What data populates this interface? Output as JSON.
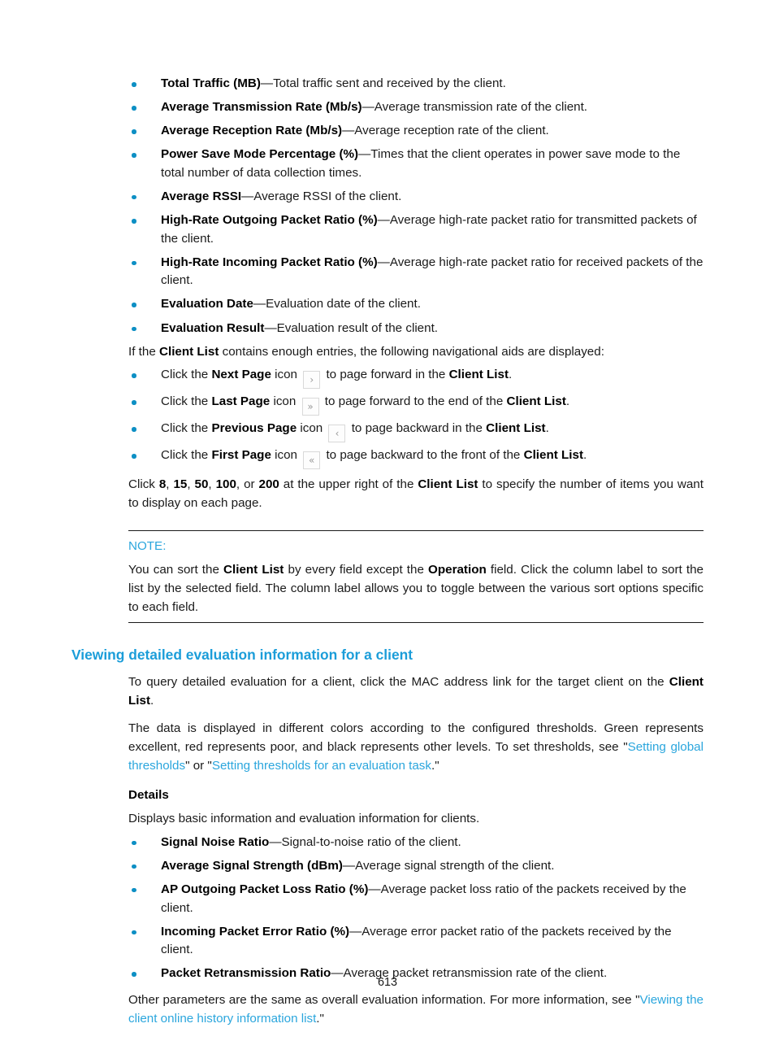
{
  "document": {
    "page_number": "613",
    "accent_color": "#1b9dd9",
    "bullet_color": "#0d8fc4",
    "link_color": "#2ba6dd"
  },
  "metrics_list": [
    {
      "term": "Total Traffic (MB)",
      "dash": "—",
      "desc": "Total traffic sent and received by the client."
    },
    {
      "term": "Average Transmission Rate (Mb/s)",
      "dash": "—",
      "desc": "Average transmission rate of the client."
    },
    {
      "term": "Average Reception Rate (Mb/s)",
      "dash": "—",
      "desc": "Average reception rate of the client."
    },
    {
      "term": "Power Save Mode Percentage (%)",
      "dash": "—",
      "desc": "Times that the client operates in power save mode to the total number of data collection times."
    },
    {
      "term": "Average RSSI",
      "dash": "—",
      "desc": "Average RSSI of the client."
    },
    {
      "term": "High-Rate Outgoing Packet Ratio (%)",
      "dash": "—",
      "desc": "Average high-rate packet ratio for transmitted packets of the client."
    },
    {
      "term": "High-Rate Incoming Packet Ratio (%)",
      "dash": "—",
      "desc": "Average high-rate packet ratio for received packets of the client."
    },
    {
      "term": "Evaluation Date",
      "dash": "—",
      "desc": "Evaluation date of the client."
    },
    {
      "term": "Evaluation Result",
      "dash": "—",
      "desc": "Evaluation result of the client."
    }
  ],
  "nav_intro": {
    "text_before": "If the ",
    "bold": "Client List",
    "text_after": " contains enough entries, the following navigational aids are displayed:"
  },
  "nav_aids": [
    {
      "click": "Click the ",
      "name": "Next Page",
      "icon_word": " icon ",
      "glyph": "›",
      "icon_name": "next-page-icon",
      "after": " to page forward in the ",
      "target": "Client List",
      "end": "."
    },
    {
      "click": "Click the ",
      "name": "Last Page",
      "icon_word": " icon ",
      "glyph": "»",
      "icon_name": "last-page-icon",
      "after": " to page forward to the end of the ",
      "target": "Client List",
      "end": "."
    },
    {
      "click": "Click the ",
      "name": "Previous Page",
      "icon_word": " icon ",
      "glyph": "‹",
      "icon_name": "previous-page-icon",
      "after": " to page backward in the ",
      "target": "Client List",
      "end": "."
    },
    {
      "click": "Click the ",
      "name": "First Page",
      "icon_word": " icon ",
      "glyph": "«",
      "icon_name": "first-page-icon",
      "after": " to page backward to the front of the ",
      "target": "Client List",
      "end": "."
    }
  ],
  "page_size_para": {
    "p1": "Click ",
    "n1": "8",
    "s1": ", ",
    "n2": "15",
    "s2": ", ",
    "n3": "50",
    "s3": ", ",
    "n4": "100",
    "s4": ", or ",
    "n5": "200",
    "p2": " at the upper right of the ",
    "bold": "Client List",
    "p3": " to specify the number of items you want to display on each page."
  },
  "note": {
    "label": "NOTE:",
    "t1": "You can sort the ",
    "b1": "Client List",
    "t2": " by every field except the ",
    "b2": "Operation",
    "t3": " field. Click the column label to sort the list by the selected field. The column label allows you to toggle between the various sort options specific to each field."
  },
  "section": {
    "heading": "Viewing detailed evaluation information for a client",
    "intro": {
      "t1": "To query detailed evaluation for a client, click the MAC address link for the target client on the ",
      "b1": "Client List",
      "t2": "."
    },
    "thresholds": {
      "t1": "The data is displayed in different colors according to the configured thresholds. Green represents excellent, red represents poor, and black represents other levels. To set thresholds, see \"",
      "link1": "Setting global thresholds",
      "t2": "\" or \"",
      "link2": "Setting thresholds for an evaluation task",
      "t3": ".\""
    },
    "details_label": "Details",
    "details_intro": "Displays basic information and evaluation information for clients.",
    "details_list": [
      {
        "term": "Signal Noise Ratio",
        "dash": "—",
        "desc": "Signal-to-noise ratio of the client."
      },
      {
        "term": "Average Signal Strength (dBm)",
        "dash": "—",
        "desc": "Average signal strength of the client."
      },
      {
        "term": "AP Outgoing Packet Loss Ratio (%)",
        "dash": "—",
        "desc": "Average packet loss ratio of the packets received by the client."
      },
      {
        "term": "Incoming Packet Error Ratio (%)",
        "dash": "—",
        "desc": "Average error packet ratio of the packets received by the client."
      },
      {
        "term": "Packet Retransmission Ratio",
        "dash": "—",
        "desc": "Average packet retransmission rate of the client."
      }
    ],
    "closing": {
      "t1": "Other parameters are the same as overall evaluation information. For more information, see \"",
      "link1": "Viewing the client online history information list",
      "t2": ".\""
    }
  }
}
